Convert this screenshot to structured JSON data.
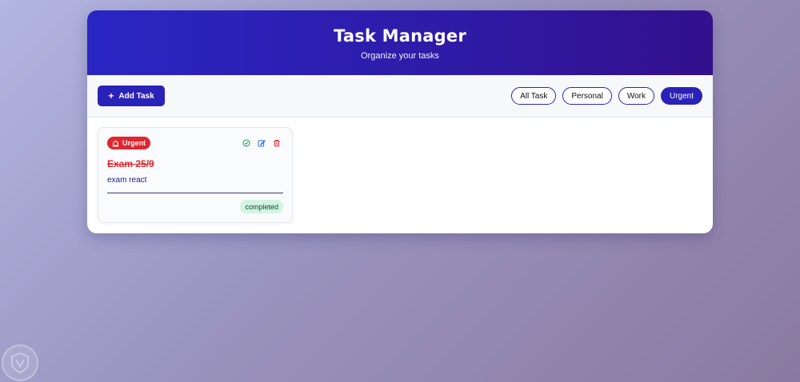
{
  "header": {
    "title": "Task Manager",
    "subtitle": "Organize your tasks"
  },
  "toolbar": {
    "add_icon": "plus-icon",
    "add_label": "Add Task",
    "filters": [
      {
        "label": "All Task",
        "active": false
      },
      {
        "label": "Personal",
        "active": false
      },
      {
        "label": "Work",
        "active": false
      },
      {
        "label": "Urgent",
        "active": true
      }
    ]
  },
  "tasks": [
    {
      "category": "Urgent",
      "category_icon": "alarm-bell-icon",
      "title": "Exam 25/9",
      "description": "exam react",
      "status": "completed",
      "action_icons": [
        "check-circle-icon",
        "edit-icon",
        "trash-icon"
      ]
    }
  ],
  "colors": {
    "primary": "#2a22b8",
    "urgent": "#e0262e",
    "completed_bg": "#d2f4e2",
    "check": "#1aa35a",
    "edit": "#2a6fdc"
  }
}
